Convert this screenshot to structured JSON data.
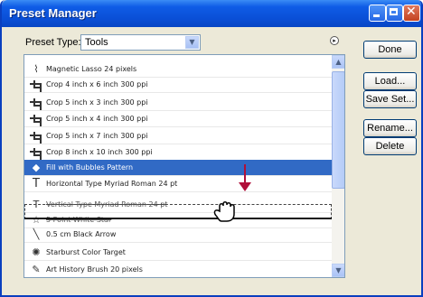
{
  "window": {
    "title": "Preset Manager"
  },
  "preset_type": {
    "label": "Preset Type:",
    "value": "Tools"
  },
  "presets": [
    {
      "name": "Magnetic Lasso 24 pixels",
      "icon": "lasso-icon"
    },
    {
      "name": "Crop 4 inch x 6 inch 300 ppi",
      "icon": "crop-icon"
    },
    {
      "name": "Crop 5 inch x 3 inch 300 ppi",
      "icon": "crop-icon"
    },
    {
      "name": "Crop 5 inch x 4 inch 300 ppi",
      "icon": "crop-icon"
    },
    {
      "name": "Crop 5 inch x 7 inch 300 ppi",
      "icon": "crop-icon"
    },
    {
      "name": "Crop 8 inch x 10 inch 300 ppi",
      "icon": "crop-icon"
    },
    {
      "name": "Fill with Bubbles Pattern",
      "icon": "paint-bucket-icon",
      "selected": true
    },
    {
      "name": "Horizontal Type Myriad Roman 24 pt",
      "icon": "type-icon"
    },
    {
      "name": "Vertical Type Myriad Roman 24 pt",
      "icon": "vertical-type-icon",
      "dragging": true
    },
    {
      "name": "5 Point White Star",
      "icon": "star-icon",
      "dragging": true
    },
    {
      "name": "0.5 cm Black Arrow",
      "icon": "line-icon"
    },
    {
      "name": "Starburst Color Target",
      "icon": "starburst-icon"
    },
    {
      "name": "Art History Brush 20 pixels",
      "icon": "art-history-brush-icon"
    }
  ],
  "buttons": {
    "done": "Done",
    "load": "Load...",
    "save_set": "Save Set...",
    "rename": "Rename...",
    "delete": "Delete"
  },
  "colors": {
    "selection": "#316ac5",
    "drag_arrow": "#b0103a",
    "titlebar": "#0a4fd6"
  }
}
